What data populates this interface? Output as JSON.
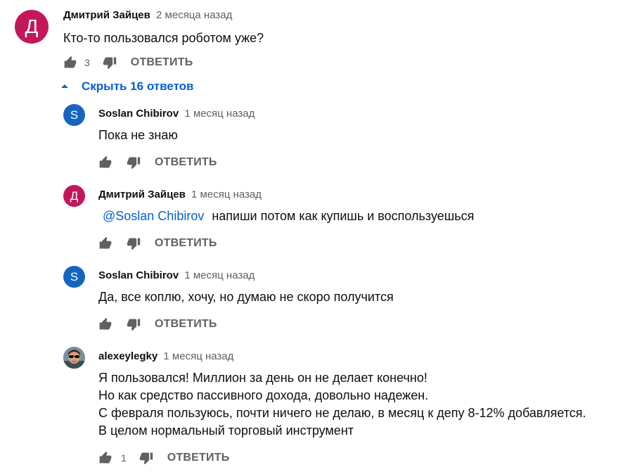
{
  "colors": {
    "author_d": "#c2185b",
    "author_s": "#1565c0",
    "link": "#065fd4",
    "meta": "#606060"
  },
  "top_comment": {
    "avatar_letter": "Д",
    "author": "Дмитрий Зайцев",
    "time": "2 месяца назад",
    "text": "Кто-то пользовался роботом уже?",
    "likes": "3",
    "reply_label": "ОТВЕТИТЬ"
  },
  "replies_toggle": {
    "label": "Скрыть 16 ответов",
    "icon": "caret-up-icon"
  },
  "replies": [
    {
      "avatar_letter": "S",
      "author": "Soslan Chibirov",
      "time": "1 месяц назад",
      "text": "Пока не знаю",
      "reply_label": "ОТВЕТИТЬ"
    },
    {
      "avatar_letter": "Д",
      "author": "Дмитрий Зайцев",
      "time": "1 месяц назад",
      "mention": "@Soslan Chibirov",
      "text": "напиши потом как купишь и воспользуешься",
      "reply_label": "ОТВЕТИТЬ"
    },
    {
      "avatar_letter": "S",
      "author": "Soslan Chibirov",
      "time": "1 месяц назад",
      "text": "Да, все коплю, хочу, но думаю не скоро получится",
      "reply_label": "ОТВЕТИТЬ"
    },
    {
      "author": "alexeylegky",
      "time": "1 месяц назад",
      "lines": [
        "Я пользовался! Миллион за день он не делает конечно!",
        "Но как средство пассивного дохода, довольно надежен.",
        "С февраля пользуюсь, почти ничего не делаю, в месяц к депу 8-12% добавляется.",
        "В целом нормальный торговый инструмент"
      ],
      "likes": "1",
      "reply_label": "ОТВЕТИТЬ"
    }
  ]
}
